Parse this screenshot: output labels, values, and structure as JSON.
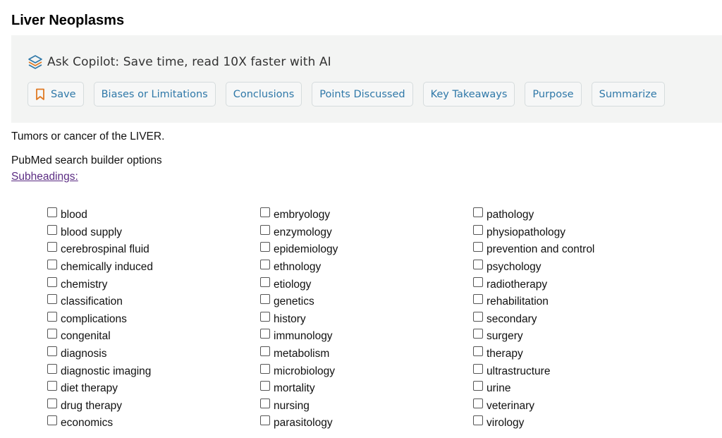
{
  "page": {
    "title": "Liver Neoplasms",
    "description": "Tumors or cancer of the LIVER.",
    "builder_label": "PubMed search builder options",
    "subheadings_link": "Subheadings:"
  },
  "copilot": {
    "title": "Ask Copilot: Save time, read 10X faster with AI",
    "logo_icon": "copilot-logo-icon",
    "actions": [
      {
        "label": "Save",
        "icon": "bookmark-icon"
      },
      {
        "label": "Biases or Limitations"
      },
      {
        "label": "Conclusions"
      },
      {
        "label": "Points Discussed"
      },
      {
        "label": "Key Takeaways"
      },
      {
        "label": "Purpose"
      },
      {
        "label": "Summarize"
      }
    ]
  },
  "subheadings": {
    "columns": [
      [
        "blood",
        "blood supply",
        "cerebrospinal fluid",
        "chemically induced",
        "chemistry",
        "classification",
        "complications",
        "congenital",
        "diagnosis",
        "diagnostic imaging",
        "diet therapy",
        "drug therapy",
        "economics"
      ],
      [
        "embryology",
        "enzymology",
        "epidemiology",
        "ethnology",
        "etiology",
        "genetics",
        "history",
        "immunology",
        "metabolism",
        "microbiology",
        "mortality",
        "nursing",
        "parasitology"
      ],
      [
        "pathology",
        "physiopathology",
        "prevention and control",
        "psychology",
        "radiotherapy",
        "rehabilitation",
        "secondary",
        "surgery",
        "therapy",
        "ultrastructure",
        "urine",
        "veterinary",
        "virology"
      ]
    ]
  },
  "colors": {
    "accent_link": "#2f78a8",
    "visited_link": "#5b2c83",
    "panel_bg": "#f3f4f3",
    "bookmark_orange": "#e07a24"
  }
}
